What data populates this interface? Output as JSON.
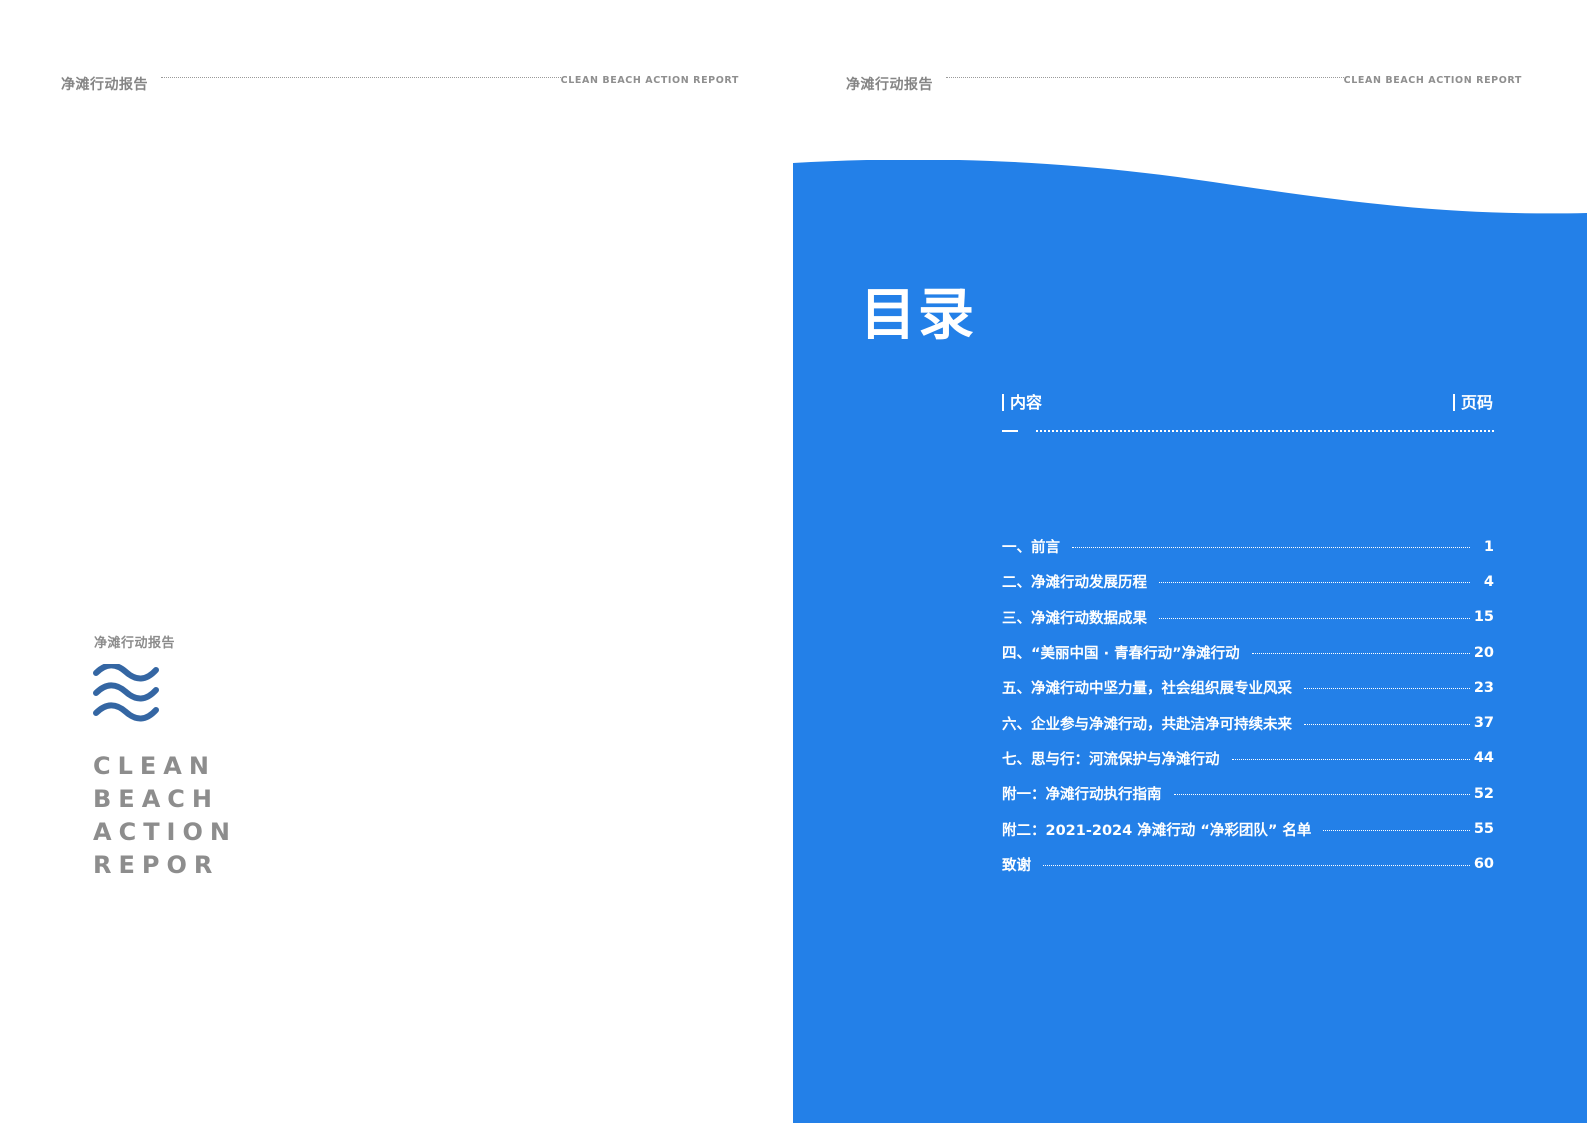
{
  "header_left": {
    "title_cn": "净滩行动报告",
    "title_en": "CLEAN BEACH ACTION REPORT"
  },
  "header_right": {
    "title_cn": "净滩行动报告",
    "title_en": "CLEAN BEACH ACTION REPORT"
  },
  "brand": {
    "title_cn": "净滩行动报告",
    "icon": "wave-icon",
    "icon_color": "#3466A3",
    "lines_en": [
      "CLEAN",
      "BEACH",
      "ACTION",
      "REPOR"
    ]
  },
  "toc": {
    "title": "目录",
    "panel_color": "#2380E8",
    "column_content": "内容",
    "column_page": "页码",
    "entries": [
      {
        "label": "一、前言",
        "page": "1"
      },
      {
        "label": "二、净滩行动发展历程",
        "page": "4"
      },
      {
        "label": "三、净滩行动数据成果",
        "page": "15"
      },
      {
        "label": "四、“美丽中国 · 青春行动”净滩行动",
        "page": "20"
      },
      {
        "label": "五、净滩行动中坚力量，社会组织展专业风采",
        "page": "23"
      },
      {
        "label": "六、企业参与净滩行动，共赴洁净可持续未来",
        "page": "37"
      },
      {
        "label": "七、思与行：河流保护与净滩行动",
        "page": "44"
      },
      {
        "label": "附一：净滩行动执行指南",
        "page": "52"
      },
      {
        "label": "附二：2021-2024 净滩行动 “净彩团队” 名单",
        "page": "55"
      },
      {
        "label": "致谢",
        "page": "60"
      }
    ]
  }
}
